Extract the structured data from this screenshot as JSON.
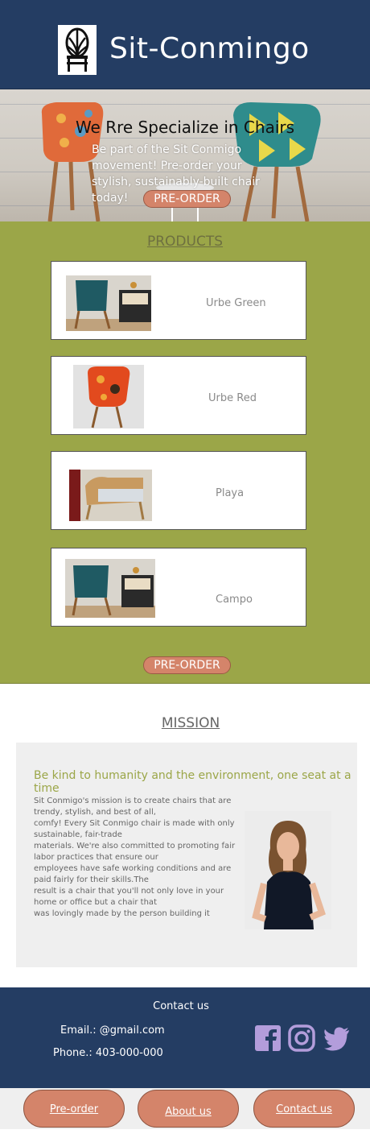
{
  "header": {
    "brand": "Sit-Conmingo",
    "logo_icon": "chair-logo-icon"
  },
  "hero": {
    "title": "We Rre Specialize in Chairs",
    "text": "Be part of the Sit Conmigo movement! Pre-order your stylish, sustainably-built chair today!",
    "button_label": "PRE-ORDER"
  },
  "products": {
    "heading": "PRODUCTS",
    "items": [
      {
        "name": "Urbe Green"
      },
      {
        "name": "Urbe Red"
      },
      {
        "name": "Playa"
      },
      {
        "name": "Campo"
      }
    ],
    "button_label": "PRE-ORDER"
  },
  "mission": {
    "heading": "MISSION",
    "tagline": "Be kind to humanity and the environment, one seat at a time",
    "lines": [
      "Sit Conmigo's mission is to create chairs that are trendy, stylish, and best of all,",
      "comfy! Every Sit Conmigo chair is made with only sustainable, fair-trade",
      "materials. We're also committed to promoting fair labor practices that ensure our",
      "employees have safe working conditions and are paid fairly for their skills.The",
      "result is a chair that you'll not only love in your home or office but a chair that",
      "was lovingly made by the person building it"
    ]
  },
  "footer": {
    "title": "Contact us",
    "email": "Email.: @gmail.com",
    "phone": "Phone.: 403-000-000",
    "social": [
      "facebook-icon",
      "instagram-icon",
      "twitter-icon"
    ],
    "social_color": "#b39ddb"
  },
  "nav": {
    "items": [
      "Pre-order",
      "About us",
      "Contact us"
    ]
  },
  "colors": {
    "header_bg": "#243d63",
    "products_bg": "#9ba648",
    "accent_button": "#d4846a",
    "mission_bg": "#efefef"
  }
}
